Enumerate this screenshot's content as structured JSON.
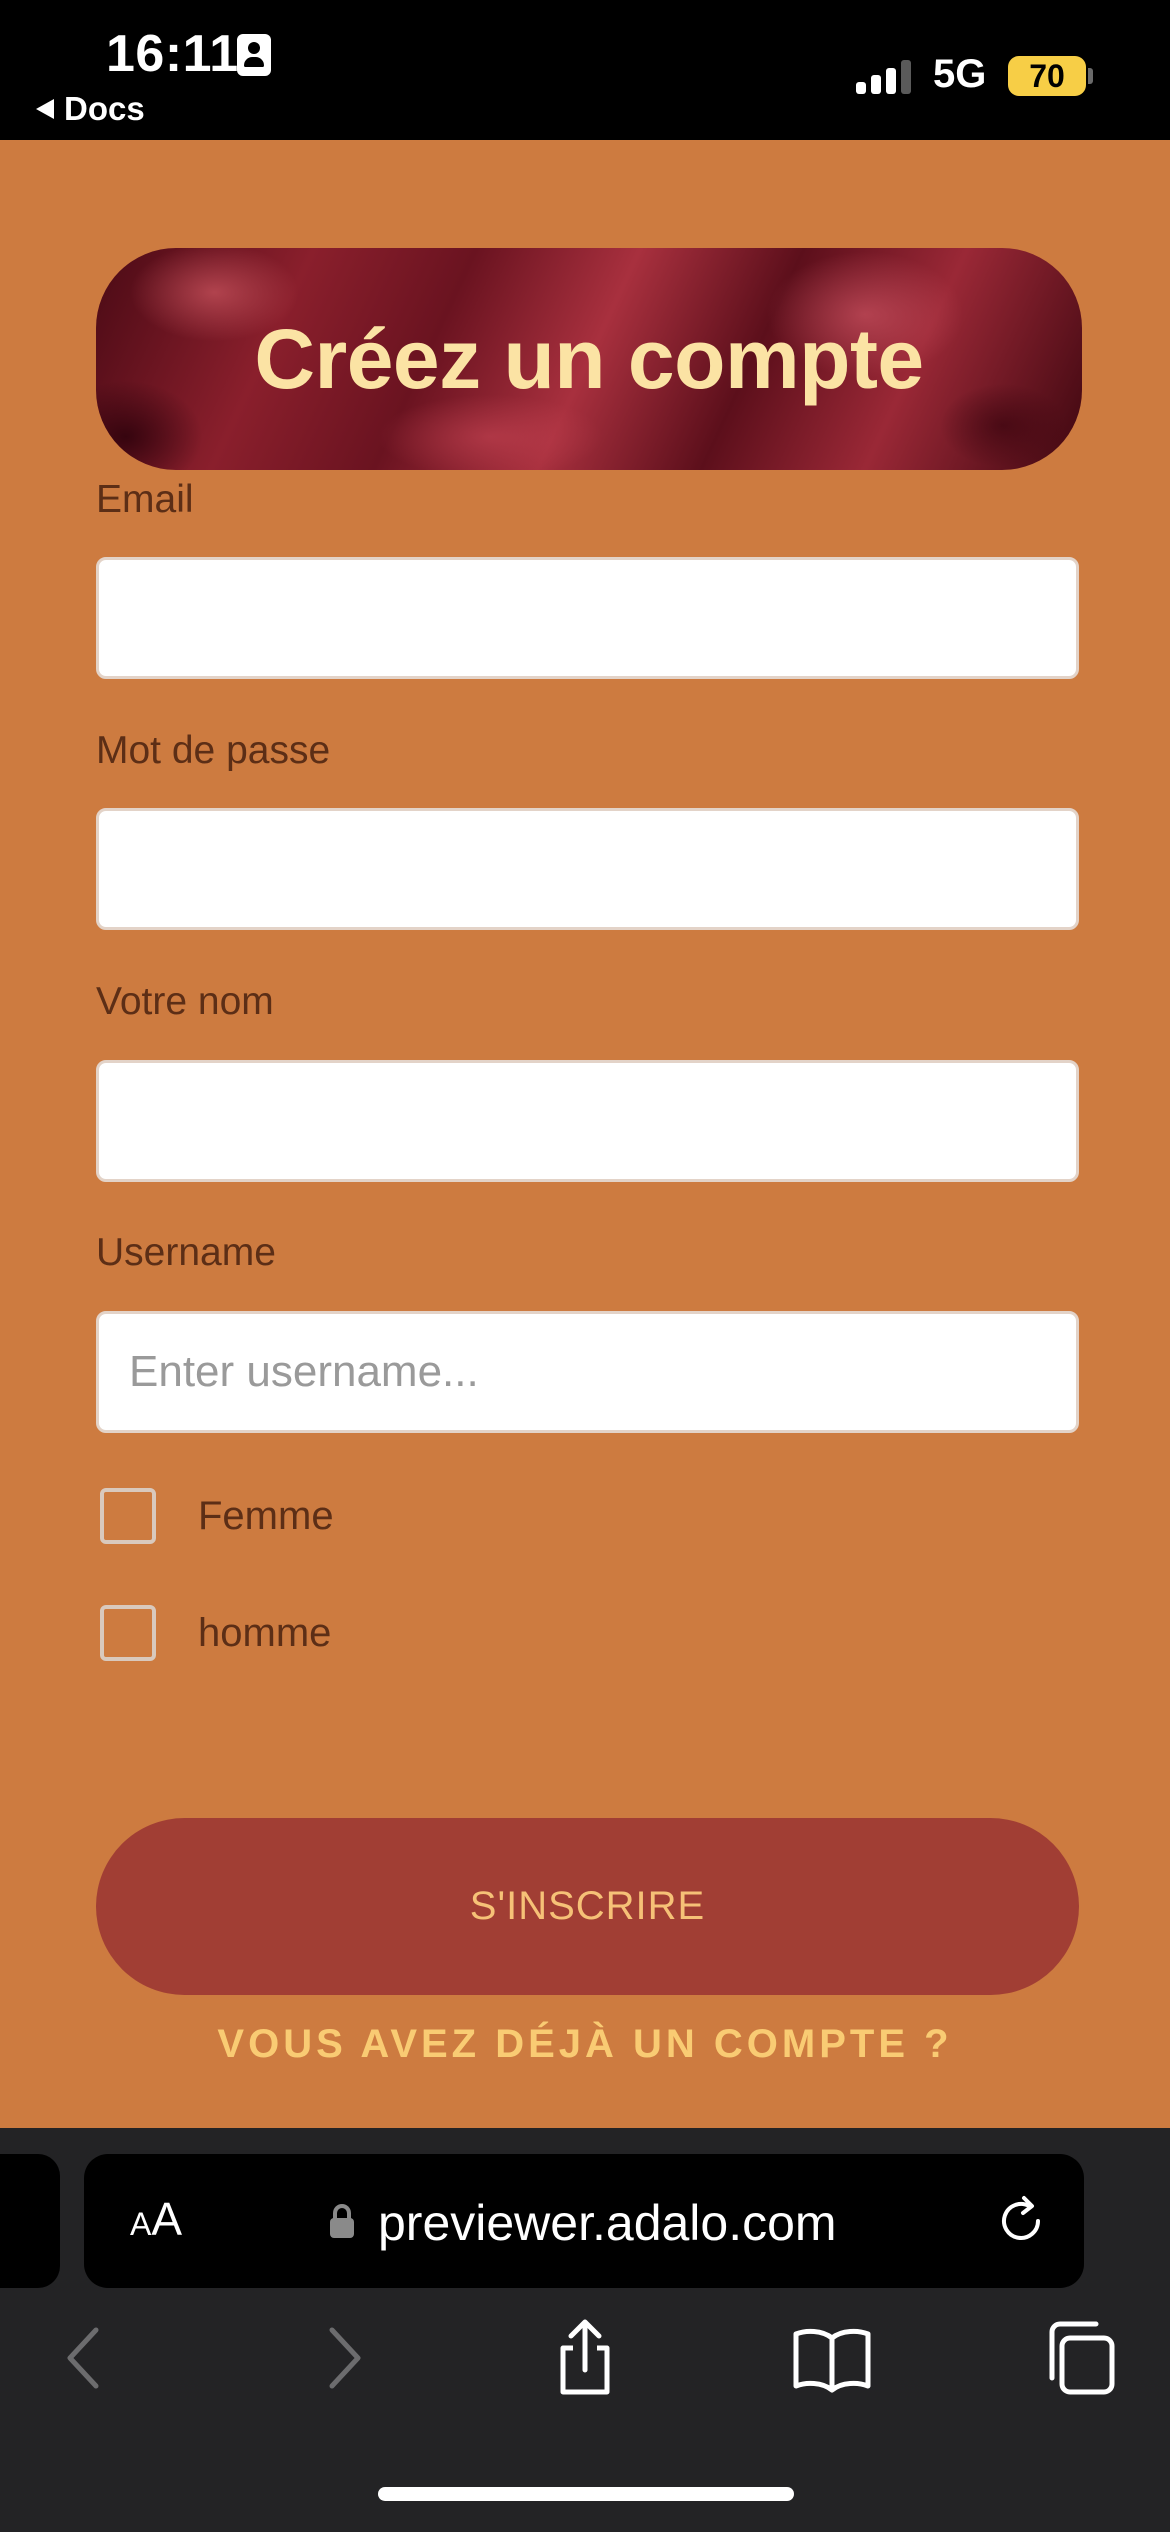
{
  "status_bar": {
    "time": "16:11",
    "back_app": "Docs",
    "network": "5G",
    "battery": "70",
    "signal_bars_active": 3,
    "signal_bars_total": 4
  },
  "form": {
    "title": "Créez un compte",
    "fields": [
      {
        "label": "Email",
        "value": "",
        "placeholder": ""
      },
      {
        "label": "Mot de passe",
        "value": "",
        "placeholder": ""
      },
      {
        "label": "Votre nom",
        "value": "",
        "placeholder": ""
      },
      {
        "label": "Username",
        "value": "",
        "placeholder": "Enter username..."
      }
    ],
    "checkboxes": [
      {
        "label": "Femme",
        "checked": false
      },
      {
        "label": "homme",
        "checked": false
      }
    ],
    "submit_label": "S'INSCRIRE",
    "login_link": "VOUS AVEZ DÉJÀ UN COMPTE ?"
  },
  "browser": {
    "text_size_label": "AA",
    "url": "previewer.adalo.com",
    "toolbar_icons": [
      "back-icon",
      "forward-icon",
      "share-icon",
      "bookmarks-icon",
      "tabs-icon"
    ]
  },
  "colors": {
    "page_background": "#CD7B40",
    "label_text": "#5C2E16",
    "title_text": "#FBE3A4",
    "button_background": "#A13E34",
    "button_text": "#F6C177",
    "link_text": "#F9CB73",
    "battery": "#F7CE46"
  }
}
